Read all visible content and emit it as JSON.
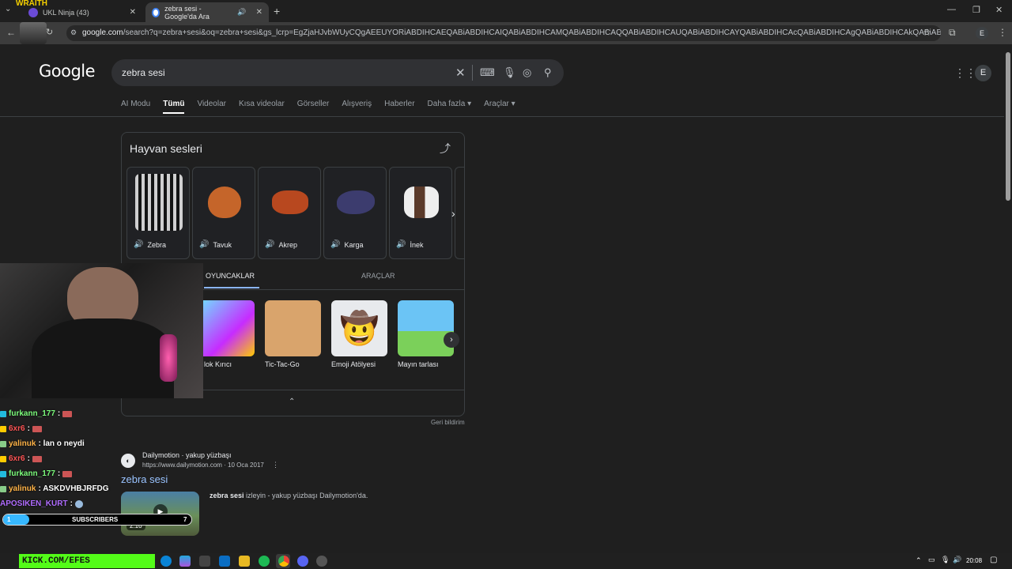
{
  "browser": {
    "tabs": [
      {
        "title": "UKL Ninja (43)",
        "active": false
      },
      {
        "title": "zebra sesi - Google'da Ara",
        "active": true
      }
    ],
    "url_domain": "google.com",
    "url_rest": "/search?q=zebra+sesi&oq=zebra+sesi&gs_lcrp=EgZjaHJvbWUyCQgAEEUYORiABDIHCAEQABiABDIHCAIQABiABDIHCAMQABiABDIHCAQQABiABDIHCAUQABiABDIHCAYQABiABDIHCAcQABiABDIHCAgQABiABDIHCAkQABiABNIBCDE1MzdqMGo...",
    "profile_initial": "E"
  },
  "overlay": {
    "brand_text": "WRAITH",
    "kick_banner": "KICK.COM/EFES"
  },
  "google": {
    "logo": "Google",
    "query": "zebra sesi",
    "account_initial": "E",
    "nav_tabs": [
      "AI Modu",
      "Tümü",
      "Videolar",
      "Kısa videolar",
      "Görseller",
      "Alışveriş",
      "Haberler",
      "Daha fazla",
      "Araçlar"
    ],
    "active_tab": "Tümü"
  },
  "animal_card": {
    "title": "Hayvan sesleri",
    "animals": [
      {
        "name": "Zebra",
        "icon": "zebra"
      },
      {
        "name": "Tavuk",
        "icon": "chicken"
      },
      {
        "name": "Akrep",
        "icon": "scorpion"
      },
      {
        "name": "Karga",
        "icon": "crow"
      },
      {
        "name": "İnek",
        "icon": "cow"
      }
    ],
    "games_tab_active": "OYUNCAKLAR",
    "games_tab_other": "ARAÇLAR",
    "games": [
      "lok Kırıcı",
      "Tic-Tac-Go",
      "Emoji Atölyesi",
      "Mayın tarlası"
    ],
    "feedback": "Geri bildirim"
  },
  "result": {
    "site": "Dailymotion · yakup yüzbaşı",
    "url": "https://www.dailymotion.com · 10 Oca 2017",
    "title": "zebra sesi",
    "snippet_bold": "zebra sesi",
    "snippet_rest": " izleyin - yakup yüzbaşı Dailymotion'da.",
    "duration": "2:10"
  },
  "chat": [
    {
      "user": "furkann_177",
      "msg": " :",
      "color": "#7cfc7c"
    },
    {
      "user": "6xr6",
      "msg": " :",
      "color": "#ff5555"
    },
    {
      "user": "yalinuk",
      "msg": " : lan o neydi",
      "color": "#ffb347"
    },
    {
      "user": "6xr6",
      "msg": " :",
      "color": "#ff5555"
    },
    {
      "user": "furkann_177",
      "msg": " :",
      "color": "#7cfc7c"
    },
    {
      "user": "yalinuk",
      "msg": " : ASKDVHBJRFDG",
      "color": "#ffb347"
    },
    {
      "user": "APOSIKEN_KURT",
      "msg": " :",
      "color": "#b06cff"
    }
  ],
  "subs": {
    "label": "SUBSCRIBERS",
    "current": "1",
    "goal": "7",
    "progress": 0.14
  },
  "taskbar": {
    "time": "20:08"
  }
}
